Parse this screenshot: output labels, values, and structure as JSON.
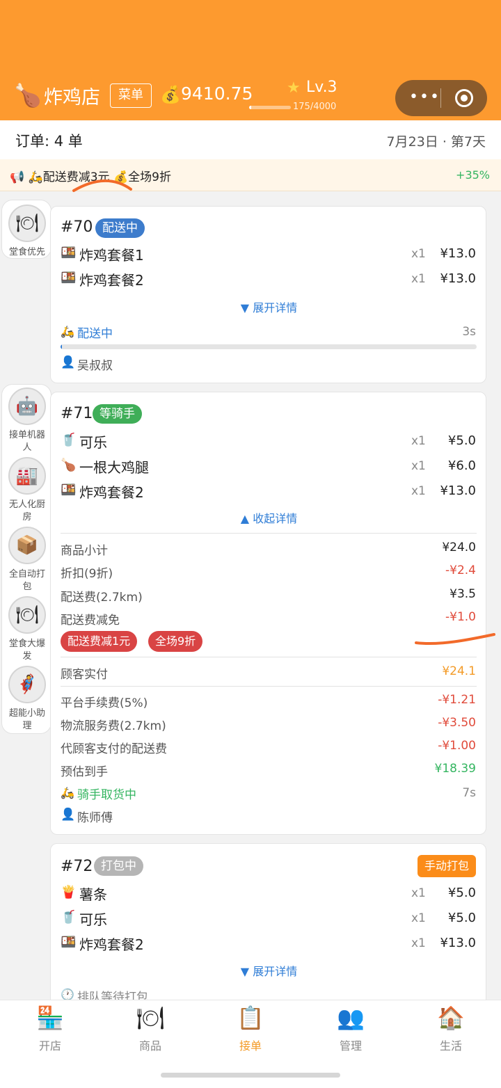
{
  "header": {
    "shop_icon": "drumstick-icon",
    "shop_name": "炸鸡店",
    "menu_label": "菜单",
    "money": "9410.75",
    "level": "Lv.3",
    "xp": "175/4000",
    "xp_fraction": 0.044
  },
  "orders_bar": {
    "count_text": "订单: 4 单",
    "date_text": "7月23日 · 第7天"
  },
  "promo_bar": {
    "text": "📢 🛵配送费减3元 💰全场9折",
    "percent": "+35%"
  },
  "side_top": [
    {
      "label": "堂食优先",
      "icon": "fork-plate-icon"
    }
  ],
  "side_tools": [
    {
      "label": "接单机器人",
      "icon": "robot-icon"
    },
    {
      "label": "无人化厨房",
      "icon": "factory-icon"
    },
    {
      "label": "全自动打包",
      "icon": "box-icon"
    },
    {
      "label": "堂食大爆发",
      "icon": "fork-plate-icon"
    },
    {
      "label": "超能小助理",
      "icon": "superhero-icon"
    }
  ],
  "orders": [
    {
      "id": "#70",
      "status": "配送中",
      "items": [
        {
          "icon": "bento-icon",
          "name": "炸鸡套餐1",
          "qty": "x1",
          "price": "¥13.0"
        },
        {
          "icon": "bento-icon",
          "name": "炸鸡套餐2",
          "qty": "x1",
          "price": "¥13.0"
        }
      ],
      "toggle": "▼ 展开详情",
      "progress_status": "配送中",
      "progress_time": "3s",
      "progress_fraction": 0.0,
      "person": "吴叔叔"
    },
    {
      "id": "#71",
      "status": "等骑手",
      "items": [
        {
          "icon": "cup-icon",
          "name": "可乐",
          "qty": "x1",
          "price": "¥5.0"
        },
        {
          "icon": "drumstick-icon",
          "name": "一根大鸡腿",
          "qty": "x1",
          "price": "¥6.0"
        },
        {
          "icon": "bento-icon",
          "name": "炸鸡套餐2",
          "qty": "x1",
          "price": "¥13.0"
        }
      ],
      "toggle": "▲ 收起详情",
      "details": [
        {
          "label": "商品小计",
          "value": "¥24.0"
        },
        {
          "label": "折扣(9折)",
          "value": "-¥2.4"
        },
        {
          "label": "配送费(2.7km)",
          "value": "¥3.5"
        },
        {
          "label": "配送费减免",
          "value": "-¥1.0"
        }
      ],
      "tags": [
        "配送费减1元",
        "全场9折"
      ],
      "paid_label": "顾客实付",
      "paid_value": "¥24.1",
      "fees": [
        {
          "label": "平台手续费(5%)",
          "value": "-¥1.21"
        },
        {
          "label": "物流服务费(2.7km)",
          "value": "-¥3.50"
        },
        {
          "label": "代顾客支付的配送费",
          "value": "-¥1.00"
        },
        {
          "label": "预估到手",
          "value": "¥18.39"
        }
      ],
      "rider_status": "骑手取货中",
      "rider_time": "7s",
      "person": "陈师傅"
    },
    {
      "id": "#72",
      "status": "打包中",
      "action": "手动打包",
      "items": [
        {
          "icon": "fries-icon",
          "name": "薯条",
          "qty": "x1",
          "price": "¥5.0"
        },
        {
          "icon": "cup-icon",
          "name": "可乐",
          "qty": "x1",
          "price": "¥5.0"
        },
        {
          "icon": "bento-icon",
          "name": "炸鸡套餐2",
          "qty": "x1",
          "price": "¥13.0"
        }
      ],
      "toggle": "▼ 展开详情",
      "queue_status": "排队等待打包"
    }
  ],
  "nav": [
    {
      "label": "开店",
      "icon": "store-24-icon"
    },
    {
      "label": "商品",
      "icon": "fork-plate-icon"
    },
    {
      "label": "接单",
      "icon": "clipboard-icon",
      "active": true
    },
    {
      "label": "管理",
      "icon": "people-icon"
    },
    {
      "label": "生活",
      "icon": "house-icon"
    }
  ],
  "colors": {
    "brand": "#fd9a2f",
    "blue": "#2f7dd6",
    "green": "#34b560",
    "red": "#e04a3a",
    "tag_red": "#d94444",
    "badge_grey": "#b5b5b5"
  }
}
